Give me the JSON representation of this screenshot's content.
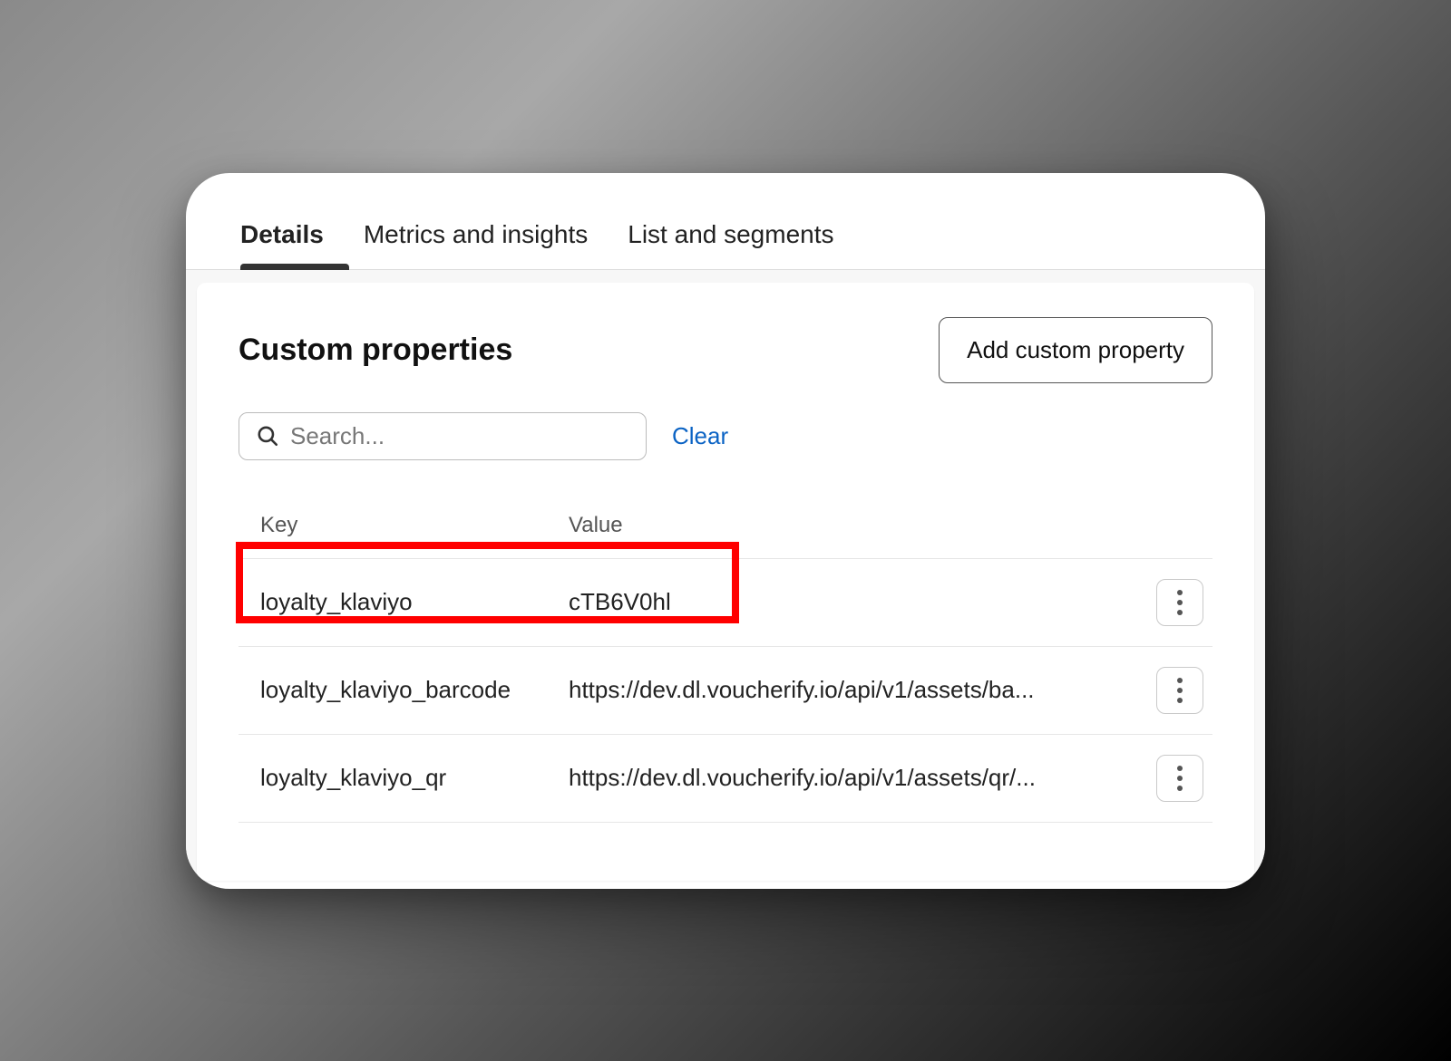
{
  "tabs": {
    "items": [
      {
        "label": "Details",
        "active": true
      },
      {
        "label": "Metrics and insights",
        "active": false
      },
      {
        "label": "List and segments",
        "active": false
      }
    ]
  },
  "panel": {
    "title": "Custom properties",
    "add_button_label": "Add custom property"
  },
  "search": {
    "placeholder": "Search...",
    "value": "",
    "clear_label": "Clear"
  },
  "table": {
    "columns": {
      "key": "Key",
      "value": "Value"
    },
    "rows": [
      {
        "key": "loyalty_klaviyo",
        "value": "cTB6V0hl",
        "highlighted": true
      },
      {
        "key": "loyalty_klaviyo_barcode",
        "value": "https://dev.dl.voucherify.io/api/v1/assets/ba...",
        "highlighted": false
      },
      {
        "key": "loyalty_klaviyo_qr",
        "value": "https://dev.dl.voucherify.io/api/v1/assets/qr/...",
        "highlighted": false
      }
    ]
  },
  "colors": {
    "link": "#0b63c4",
    "highlight": "#ff0000"
  }
}
